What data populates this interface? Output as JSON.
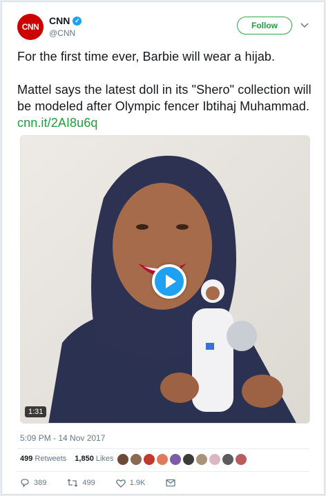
{
  "account": {
    "avatar_text": "CNN",
    "display_name": "CNN",
    "handle": "@CNN",
    "verified": true
  },
  "follow_label": "Follow",
  "tweet": {
    "line1": "For the first time ever, Barbie will wear a hijab.",
    "line2": "Mattel says the latest doll in its \"Shero\" collection will be modeled after Olympic fencer Ibtihaj Muhammad.",
    "link": "cnn.it/2AI8u6q"
  },
  "media": {
    "duration": "1:31",
    "type": "video"
  },
  "timestamp": "5:09 PM - 14 Nov 2017",
  "stats": {
    "retweets_count": "499",
    "retweets_label": "Retweets",
    "likes_count": "1,850",
    "likes_label": "Likes"
  },
  "likers": [
    "#6b4a3a",
    "#8a6a50",
    "#c0392b",
    "#e07a5f",
    "#7d5ba6",
    "#3b3b3b",
    "#a8927a",
    "#d9b8c4",
    "#5c5c5c",
    "#b85c5c"
  ],
  "actions": {
    "reply_count": "389",
    "retweet_count": "499",
    "like_count": "1.9K"
  },
  "colors": {
    "accent": "#1da1f2",
    "follow_green": "#1e9e3c",
    "brand_red": "#cc0000"
  }
}
